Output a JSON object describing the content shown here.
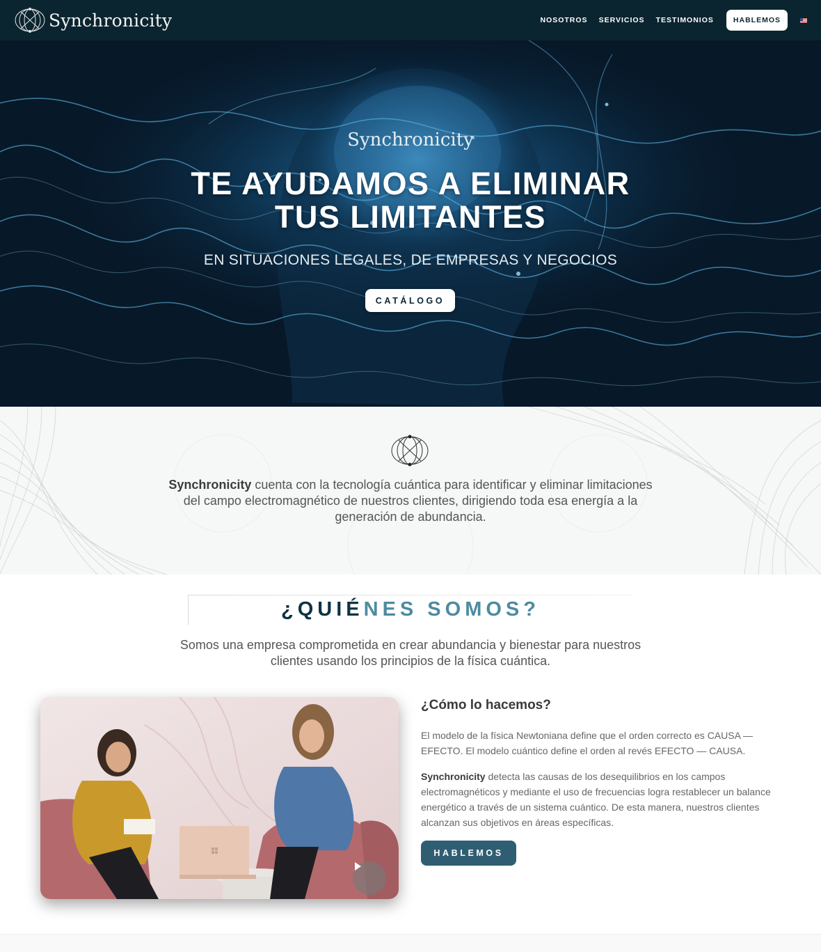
{
  "navbar": {
    "brand": "Synchronicity",
    "links": [
      "NOSOTROS",
      "SERVICIOS",
      "TESTIMONIOS"
    ],
    "cta": "HABLEMOS",
    "language_icon": "us-flag-icon"
  },
  "hero": {
    "brand": "Synchronicity",
    "title_line1": "TE AYUDAMOS A ELIMINAR",
    "title_line2": "TUS LIMITANTES",
    "subtitle": "EN SITUACIONES LEGALES, DE EMPRESAS Y NEGOCIOS",
    "button": "CATÁLOGO"
  },
  "intro": {
    "brand": "Synchronicity",
    "text": " cuenta con la tecnología cuántica para identificar y eliminar limitaciones del campo electromagnético de nuestros clientes, dirigiendo toda esa energía a la generación de abundancia."
  },
  "quienes": {
    "title_dark": "¿QUIÉ",
    "title_teal": "NES SOMOS?",
    "subtitle": "Somos una empresa comprometida en crear abundancia y bienestar para nuestros clientes usando los principios de la física cuántica.",
    "how_title": "¿Cómo lo hacemos?",
    "paragraph1": "El modelo de la física Newtoniana define que el orden correcto es CAUSA — EFECTO. El modelo cuántico define el orden al revés EFECTO — CAUSA.",
    "paragraph2_brand": "Synchronicity",
    "paragraph2": " detecta las causas de los desequilibrios en los campos electromagnéticos y mediante el uso de frecuencias logra restablecer un balance energético a través de un sistema cuántico. De esta manera, nuestros clientes alcanzan sus objetivos en áreas específicas.",
    "button": "HABLEMOS",
    "video_icon": "play-icon"
  },
  "colors": {
    "navbar_bg": "#0b2530",
    "teal_accent": "#4d8ba1",
    "dark_title": "#0d3342",
    "button_dark": "#2f5e73"
  }
}
